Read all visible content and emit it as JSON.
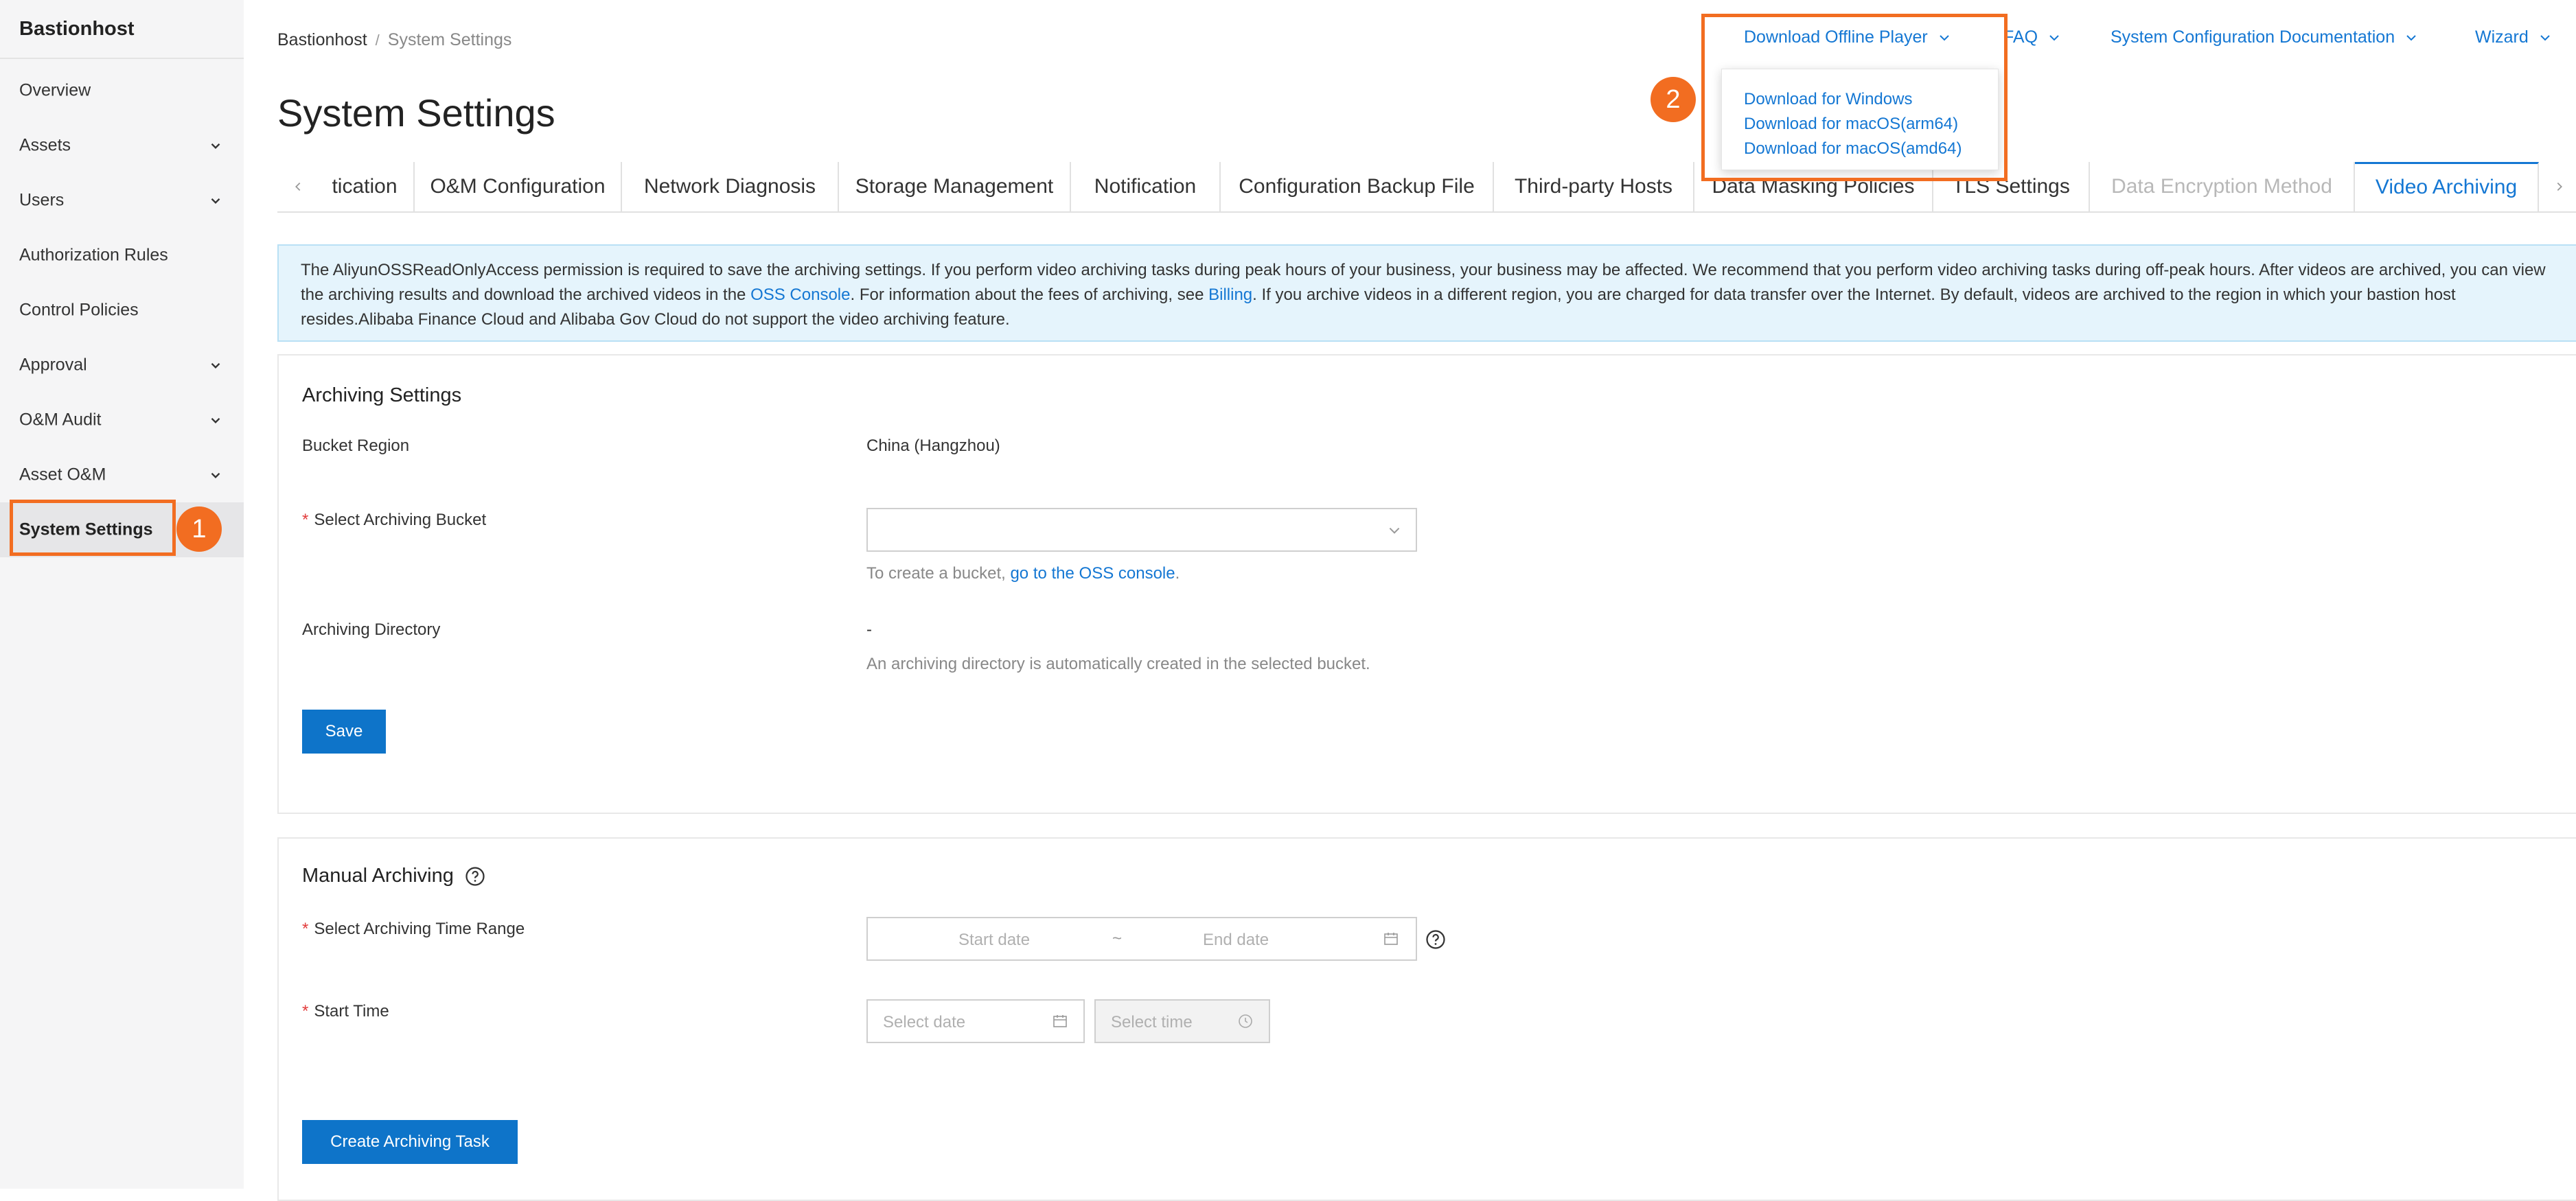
{
  "sidebar": {
    "brand": "Bastionhost",
    "items": [
      {
        "label": "Overview",
        "has_children": false
      },
      {
        "label": "Assets",
        "has_children": true
      },
      {
        "label": "Users",
        "has_children": true
      },
      {
        "label": "Authorization Rules",
        "has_children": false
      },
      {
        "label": "Control Policies",
        "has_children": false
      },
      {
        "label": "Approval",
        "has_children": true
      },
      {
        "label": "O&M Audit",
        "has_children": true
      },
      {
        "label": "Asset O&M",
        "has_children": true
      },
      {
        "label": "System Settings",
        "has_children": false,
        "active": true
      }
    ]
  },
  "annotations": {
    "step1": "1",
    "step2": "2",
    "highlight_color": "#f26d21"
  },
  "header": {
    "breadcrumb": [
      "Bastionhost",
      "System Settings"
    ],
    "breadcrumb_sep": "/",
    "title": "System Settings",
    "links": {
      "download_player": "Download Offline Player",
      "faq": "FAQ",
      "docs": "System Configuration Documentation",
      "wizard": "Wizard"
    }
  },
  "download_menu": {
    "items": [
      "Download for Windows",
      "Download for macOS(arm64)",
      "Download for macOS(amd64)"
    ]
  },
  "tabs": {
    "items": [
      {
        "label": "tication"
      },
      {
        "label": "O&M Configuration"
      },
      {
        "label": "Network Diagnosis"
      },
      {
        "label": "Storage Management"
      },
      {
        "label": "Notification"
      },
      {
        "label": "Configuration Backup File"
      },
      {
        "label": "Third-party Hosts"
      },
      {
        "label": "Data Masking Policies"
      },
      {
        "label": "TLS Settings"
      },
      {
        "label": "Data Encryption Method",
        "disabled": true
      },
      {
        "label": "Video Archiving",
        "active": true
      }
    ]
  },
  "notice": {
    "part1": "The AliyunOSSReadOnlyAccess permission is required to save the archiving settings. If you perform video archiving tasks during peak hours of your business, your business may be affected. We recommend that you perform video archiving tasks during off-peak hours. After videos are archived, you can view the archiving results and download the archived videos in the ",
    "link1": "OSS Console",
    "part2": ". For information about the fees of archiving, see ",
    "link2": "Billing",
    "part3": ". If you archive videos in a different region, you are charged for data transfer over the Internet. By default, videos are archived to the region in which your bastion host resides.Alibaba Finance Cloud and Alibaba Gov Cloud do not support the video archiving feature."
  },
  "archiving_settings": {
    "title": "Archiving Settings",
    "bucket_region_label": "Bucket Region",
    "bucket_region_value": "China (Hangzhou)",
    "bucket_label": "Select Archiving Bucket",
    "bucket_value": "",
    "bucket_hint_prefix": "To create a bucket, ",
    "bucket_hint_link": "go to the OSS console",
    "bucket_hint_suffix": ".",
    "directory_label": "Archiving Directory",
    "directory_value": "-",
    "directory_hint": "An archiving directory is automatically created in the selected bucket.",
    "save_label": "Save"
  },
  "manual_archiving": {
    "title": "Manual Archiving",
    "time_range_label": "Select Archiving Time Range",
    "start_placeholder": "Start date",
    "range_sep": "~",
    "end_placeholder": "End date",
    "start_time_label": "Start Time",
    "date_placeholder": "Select date",
    "time_placeholder": "Select time",
    "create_label": "Create Archiving Task"
  }
}
